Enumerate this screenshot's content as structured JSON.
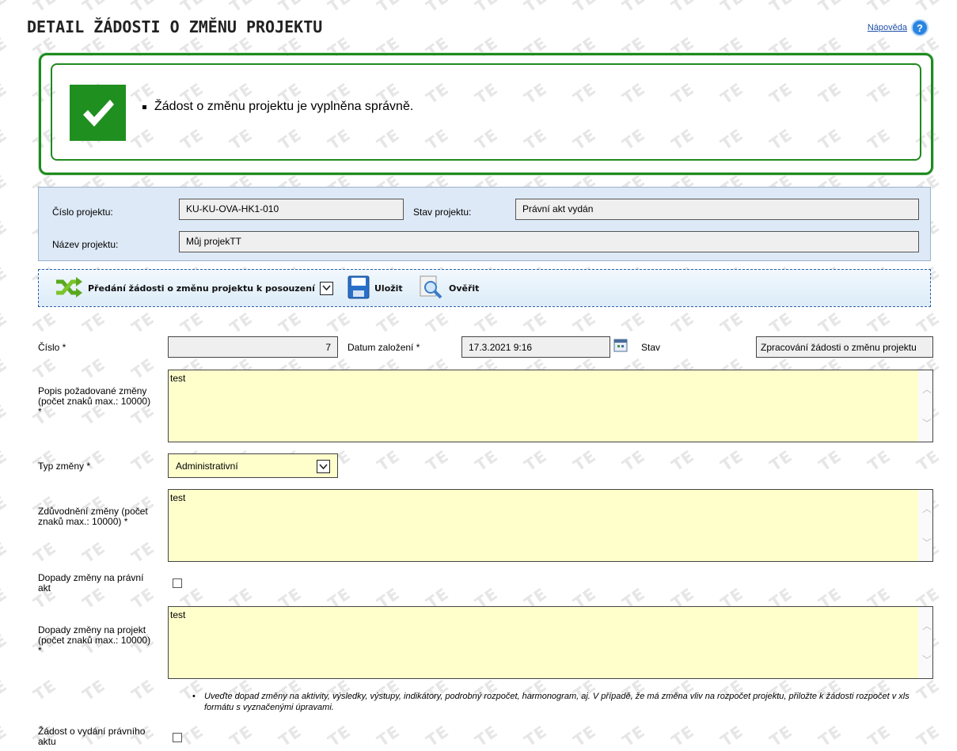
{
  "watermark": "TEST",
  "header": {
    "title": "DETAIL ŽÁDOSTI O ZMĚNU PROJEKTU",
    "help_link": "Nápověda",
    "help_icon": "help-icon"
  },
  "success": {
    "message": "Žádost o změnu projektu je vyplněna správně.",
    "icon": "checkmark-icon"
  },
  "project": {
    "cislo_label": "Číslo projektu:",
    "cislo_value": "KU-KU-OVA-HK1-010",
    "stav_label": "Stav projektu:",
    "stav_value": "Právní akt vydán",
    "nazev_label": "Název projektu:",
    "nazev_value": "Můj projekTT"
  },
  "toolbar": {
    "submit_label": "Předání žádosti o změnu projektu k posouzení",
    "save_label": "Uložit",
    "verify_label": "Ověřit"
  },
  "form": {
    "cislo_label": "Číslo *",
    "cislo_value": "7",
    "datum_label": "Datum založení *",
    "datum_value": "17.3.2021 9:16",
    "stav_label": "Stav",
    "stav_value": "Zpracování žádosti o změnu projektu",
    "popis_label": "Popis požadované změny (počet znaků max.: 10000) *",
    "popis_value": "test",
    "typ_label": "Typ změny *",
    "typ_value": "Administrativní",
    "zduvodneni_label": "Zdůvodnění změny (počet znaků max.: 10000) *",
    "zduvodneni_value": "test",
    "dopady_akt_label": "Dopady změny na právní akt",
    "dopady_projekt_label": "Dopady změny na projekt (počet znaků max.: 10000) *",
    "dopady_projekt_value": "test",
    "note": "Uveďte dopad změny na aktivity, výsledky, výstupy, indikátory, podrobný rozpočet, harmonogram, aj. V případě, že má změna vliv na rozpočet projektu, přiložte k žádosti rozpočet v xls formátu s vyznačenými úpravami.",
    "zadost_label": "Žádost o vydání právního aktu"
  },
  "colors": {
    "success_green": "#1f8f1f",
    "field_yellow": "#ffffcc",
    "project_bg": "#dde9f6"
  }
}
